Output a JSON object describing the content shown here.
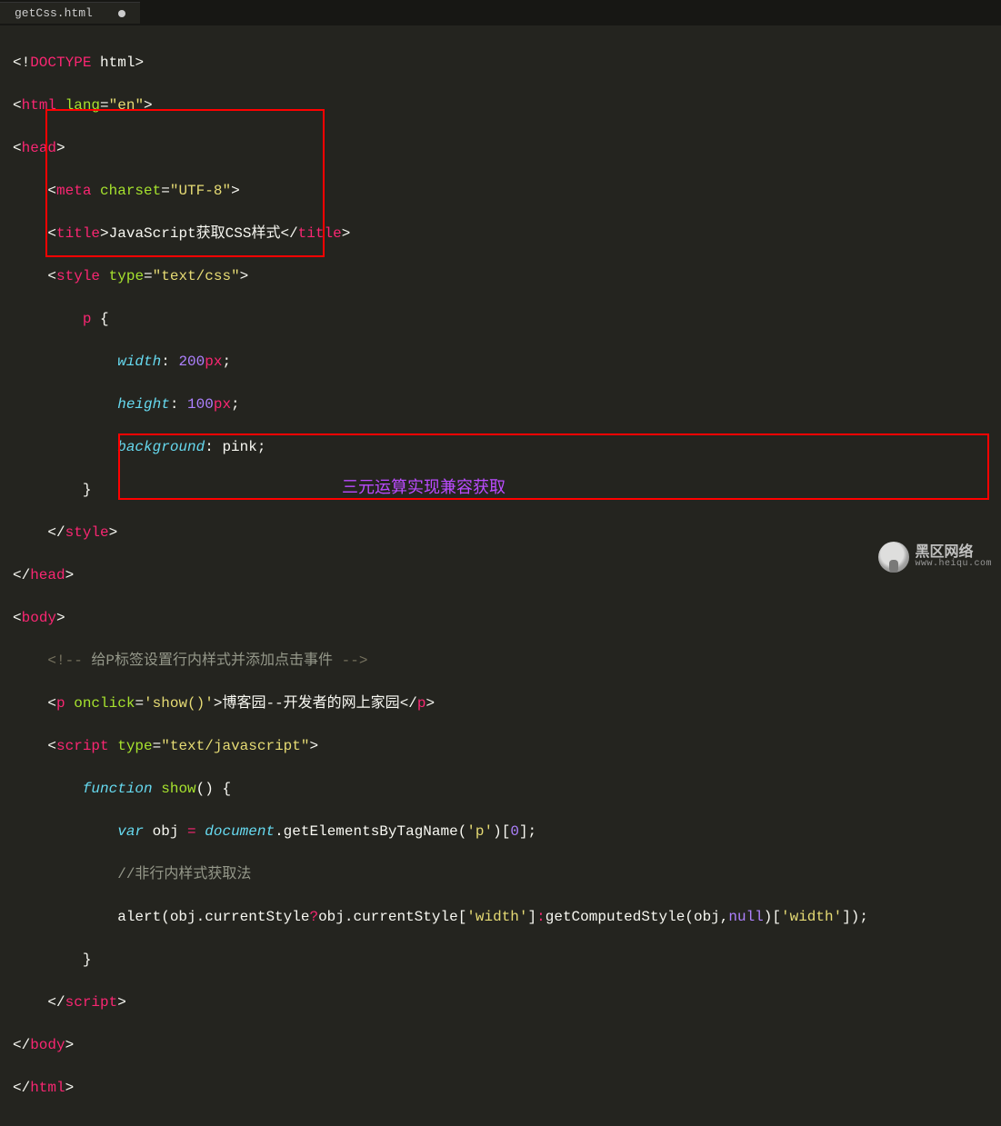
{
  "tab": {
    "name": "getCss.html"
  },
  "code": {
    "l1": {
      "a": "<!",
      "b": "DOCTYPE",
      "c": " html",
      "d": ">"
    },
    "l2": {
      "a": "<",
      "b": "html",
      "c": " lang",
      "d": "=",
      "e": "\"en\"",
      "f": ">"
    },
    "l3": {
      "a": "<",
      "b": "head",
      "c": ">"
    },
    "l4": {
      "a": "    <",
      "b": "meta",
      "c": " charset",
      "d": "=",
      "e": "\"UTF-8\"",
      "f": ">"
    },
    "l5": {
      "a": "    <",
      "b": "title",
      "c": ">",
      "d": "JavaScript获取CSS样式",
      "e": "</",
      "f": "title",
      "g": ">"
    },
    "l6": {
      "a": "    <",
      "b": "style",
      "c": " type",
      "d": "=",
      "e": "\"text/css\"",
      "f": ">"
    },
    "l7": {
      "a": "        ",
      "b": "p",
      "c": " {"
    },
    "l8": {
      "a": "            ",
      "b": "width",
      "c": ": ",
      "d": "200",
      "e": "px",
      "f": ";"
    },
    "l9": {
      "a": "            ",
      "b": "height",
      "c": ": ",
      "d": "100",
      "e": "px",
      "f": ";"
    },
    "l10": {
      "a": "            ",
      "b": "background",
      "c": ": ",
      "d": "pink",
      "e": ";"
    },
    "l11": {
      "a": "        }"
    },
    "l12": {
      "a": "    </",
      "b": "style",
      "c": ">"
    },
    "l13": {
      "a": "</",
      "b": "head",
      "c": ">"
    },
    "l14": {
      "a": "<",
      "b": "body",
      "c": ">"
    },
    "l15": {
      "a": "    ",
      "b": "<!-- ",
      "c": "给P标签设置行内样式并添加点击事件",
      "d": " -->"
    },
    "l16": {
      "a": "    <",
      "b": "p",
      "c": " onclick",
      "d": "=",
      "e": "'show()'",
      "f": ">",
      "g": "博客园--开发者的网上家园",
      "h": "</",
      "i": "p",
      "j": ">"
    },
    "l17": {
      "a": "    <",
      "b": "script",
      "c": " type",
      "d": "=",
      "e": "\"text/javascript\"",
      "f": ">"
    },
    "l18": {
      "a": "        ",
      "b": "function",
      "c": " ",
      "d": "show",
      "e": "() {"
    },
    "l19": {
      "a": "            ",
      "b": "var",
      "c": " obj ",
      "d": "=",
      "e": " ",
      "f": "document",
      "g": ".getElementsByTagName(",
      "h": "'p'",
      "i": ")[",
      "j": "0",
      "k": "];"
    },
    "l20": {
      "a": "            ",
      "b": "//非行内样式获取法"
    },
    "l21": {
      "a": "            alert(obj.currentStyle",
      "b": "?",
      "c": "obj.currentStyle[",
      "d": "'width'",
      "e": "]",
      "f": ":",
      "g": "getComputedStyle(obj,",
      "h": "null",
      "i": ")[",
      "j": "'width'",
      "k": "]);"
    },
    "l22": {
      "a": "        }"
    },
    "l23": {
      "a": "    </",
      "b": "script",
      "c": ">"
    },
    "l24": {
      "a": "</",
      "b": "body",
      "c": ">"
    },
    "l25": {
      "a": "</",
      "b": "html",
      "c": ">"
    }
  },
  "annotation": "三元运算实现兼容获取",
  "watermark": {
    "title": "黑区网络",
    "url": "www.heiqu.com"
  }
}
